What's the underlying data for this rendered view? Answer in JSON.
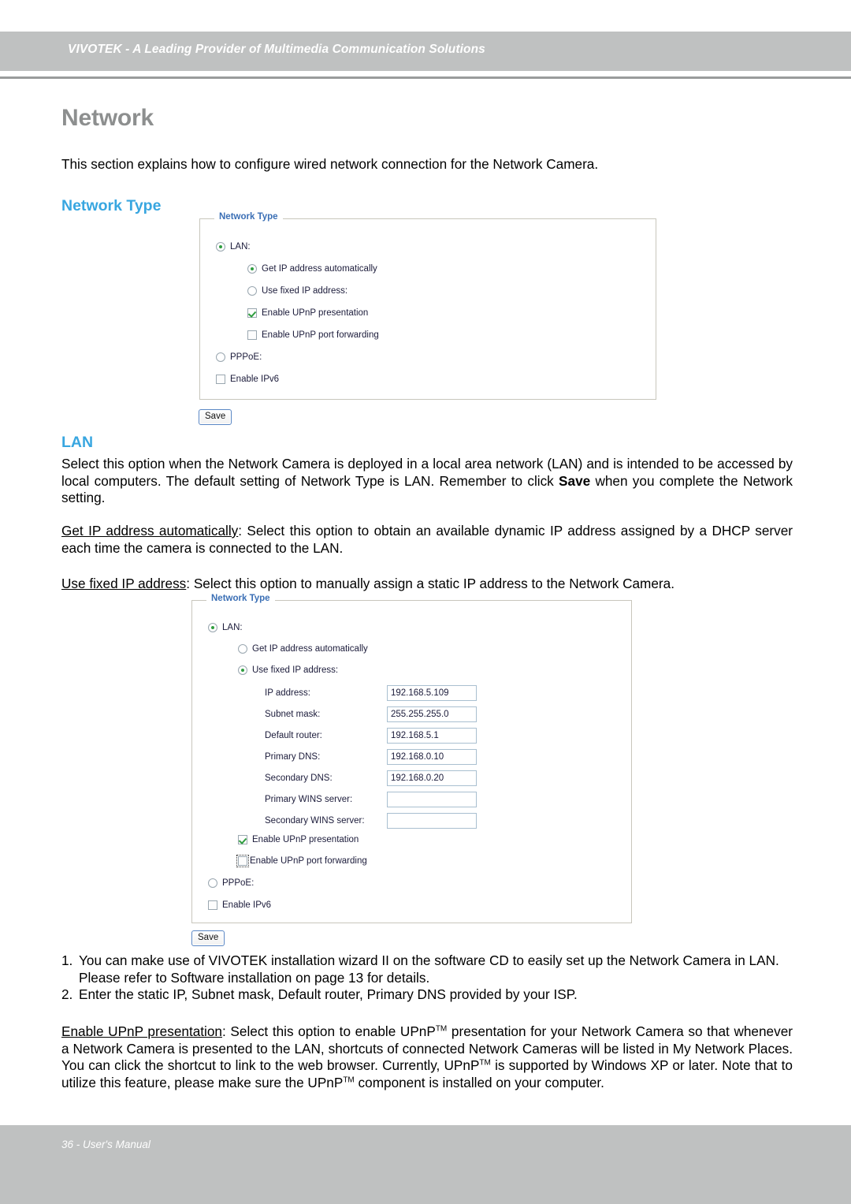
{
  "header": {
    "banner_text": "VIVOTEK - A Leading Provider of Multimedia Communication Solutions"
  },
  "page": {
    "title": "Network",
    "intro": "This section explains how to configure wired network connection for the Network Camera."
  },
  "sections": {
    "network_type_heading": "Network Type",
    "lan_heading": "LAN",
    "lan_paragraph_1": "Select this option when the Network Camera is deployed in a local area network (LAN) and is intended to be accessed by local computers. The default setting of Network Type is LAN. Remember to click ",
    "lan_paragraph_1_bold": "Save",
    "lan_paragraph_1_end": " when you complete the Network setting.",
    "get_ip_term": "Get IP address automatically",
    "get_ip_body": ": Select this option to obtain an available dynamic IP address assigned by a DHCP server each time the camera is connected to the LAN.",
    "use_fixed_term": "Use fixed IP address",
    "use_fixed_body": ": Select this option to manually assign a static IP address to the Network Camera.",
    "upnp_term": "Enable UPnP presentation",
    "upnp_body_1": ": Select this option to enable UPnP",
    "upnp_body_2": " presentation for your Network Camera so that whenever a Network Camera is presented to the LAN, shortcuts of connected Network Cameras will be listed in My Network Places. You can click the shortcut to link to the web browser. Currently, UPnP",
    "upnp_body_3": " is supported by Windows XP or later. Note that to utilize this feature, please make sure the UPnP",
    "upnp_body_4": " component is installed on your computer.",
    "tm": "TM"
  },
  "numbered_list": [
    {
      "num": "1.",
      "text": "You can make use of VIVOTEK installation wizard II on the software CD to easily set up the Network Camera in LAN. Please refer to Software installation on page 13 for details."
    },
    {
      "num": "2.",
      "text": "Enter the static IP, Subnet mask, Default router, Primary DNS provided by your ISP."
    }
  ],
  "form_top": {
    "legend": "Network Type",
    "lan_label": "LAN:",
    "lan_selected": true,
    "get_ip_label": "Get IP address automatically",
    "get_ip_selected": true,
    "use_fixed_label": "Use fixed IP address:",
    "use_fixed_selected": false,
    "upnp_presentation_label": "Enable UPnP presentation",
    "upnp_presentation_checked": true,
    "upnp_forwarding_label": "Enable UPnP port forwarding",
    "upnp_forwarding_checked": false,
    "pppoe_label": "PPPoE:",
    "pppoe_selected": false,
    "ipv6_label": "Enable IPv6",
    "ipv6_checked": false,
    "save_label": "Save"
  },
  "form_bottom": {
    "legend": "Network Type",
    "lan_label": "LAN:",
    "lan_selected": true,
    "get_ip_label": "Get IP address automatically",
    "get_ip_selected": false,
    "use_fixed_label": "Use fixed IP address:",
    "use_fixed_selected": true,
    "fields": [
      {
        "label": "IP address:",
        "value": "192.168.5.109"
      },
      {
        "label": "Subnet mask:",
        "value": "255.255.255.0"
      },
      {
        "label": "Default router:",
        "value": "192.168.5.1"
      },
      {
        "label": "Primary DNS:",
        "value": "192.168.0.10"
      },
      {
        "label": "Secondary DNS:",
        "value": "192.168.0.20"
      },
      {
        "label": "Primary WINS server:",
        "value": ""
      },
      {
        "label": "Secondary WINS server:",
        "value": ""
      }
    ],
    "upnp_presentation_label": "Enable UPnP presentation",
    "upnp_presentation_checked": true,
    "upnp_forwarding_label": "Enable UPnP port forwarding",
    "upnp_forwarding_checked": false,
    "pppoe_label": "PPPoE:",
    "pppoe_selected": false,
    "ipv6_label": "Enable IPv6",
    "ipv6_checked": false,
    "save_label": "Save"
  },
  "footer": {
    "text": "36 - User's Manual"
  },
  "colors": {
    "header_band": "#bfc1c1",
    "heading_gray": "#8d8f8f",
    "section_blue": "#38a6e0",
    "legend_blue": "#3b6fb5",
    "control_green": "#2f9e3f"
  }
}
